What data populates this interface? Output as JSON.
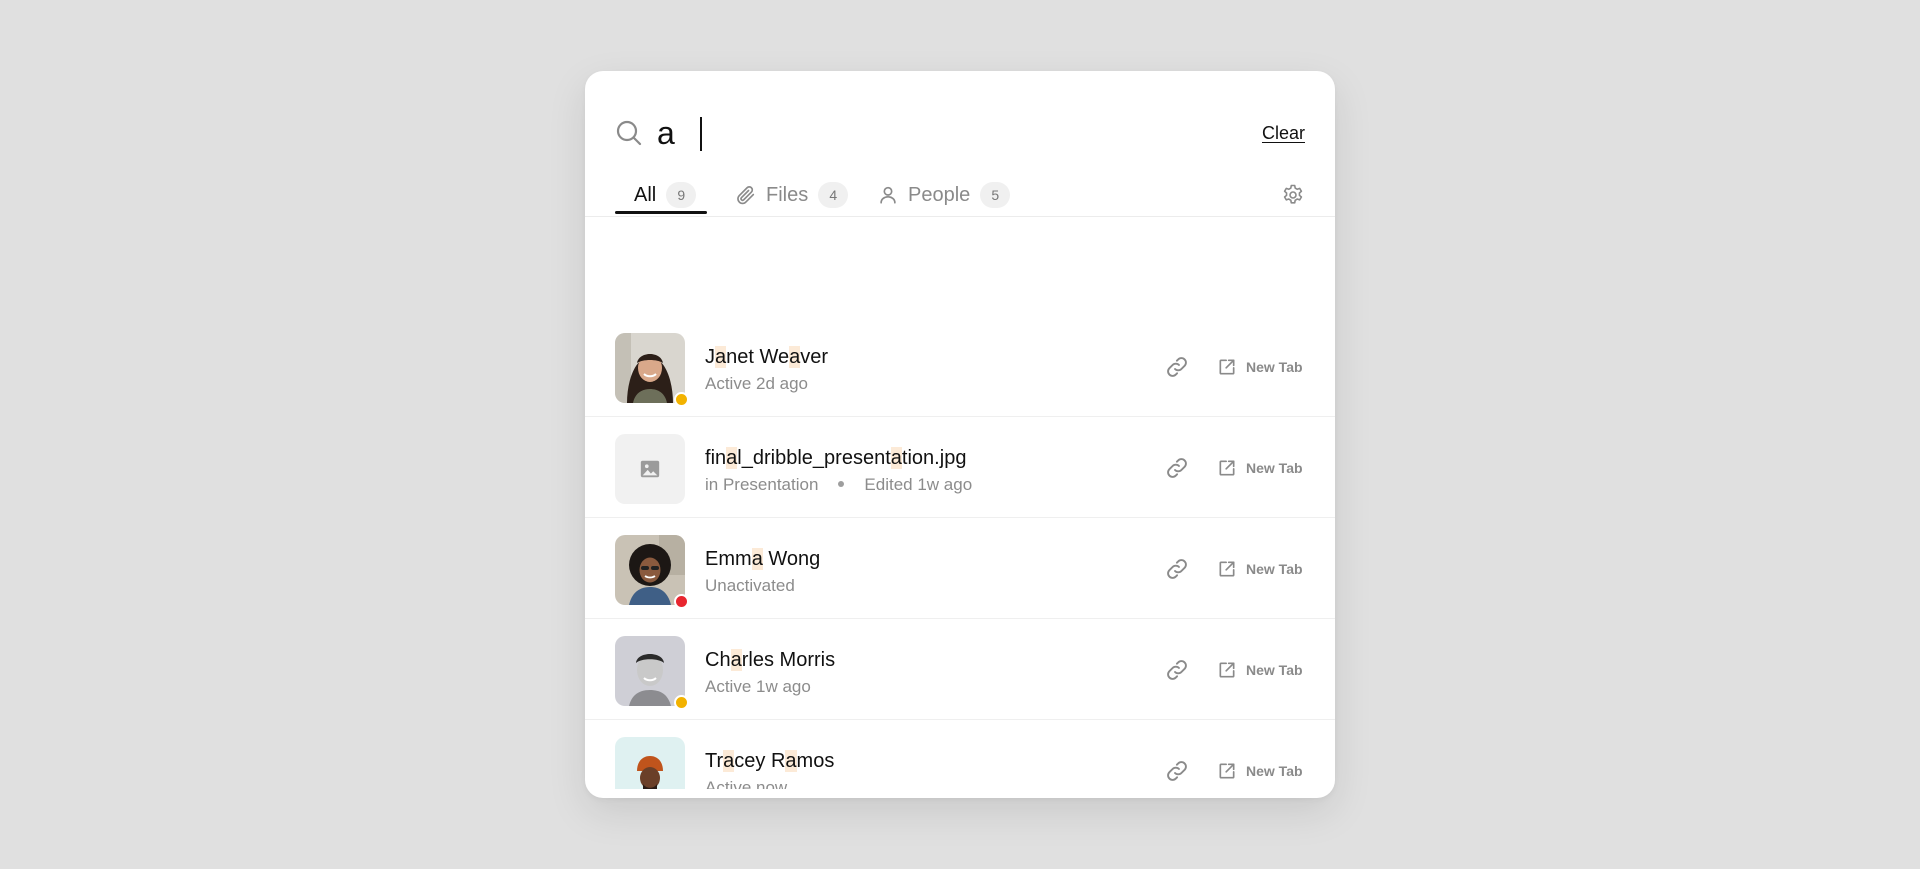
{
  "search": {
    "value": "a",
    "clear_label": "Clear"
  },
  "tabs": [
    {
      "label": "All",
      "count": "9",
      "icon": "",
      "active": true
    },
    {
      "label": "Files",
      "count": "4",
      "icon": "paperclip-icon",
      "active": false
    },
    {
      "label": "People",
      "count": "5",
      "icon": "user-icon",
      "active": false
    }
  ],
  "settings_icon": "gear-icon",
  "colors": {
    "status_away": "#f2b200",
    "status_inactive": "#e8262f",
    "highlight": "#fcead7"
  },
  "results": [
    {
      "type": "person",
      "title": "Janet Weaver",
      "subtitle": "Active 2d ago",
      "status": "away",
      "action_label": "New Tab"
    },
    {
      "type": "file",
      "title": "final_dribble_presentation.jpg",
      "location": "in Presentation",
      "edited": "Edited 1w ago",
      "action_label": "New Tab"
    },
    {
      "type": "person",
      "title": "Emma Wong",
      "subtitle": "Unactivated",
      "status": "inactive",
      "action_label": "New Tab"
    },
    {
      "type": "person",
      "title": "Charles Morris",
      "subtitle": "Active 1w ago",
      "status": "away",
      "action_label": "New Tab"
    },
    {
      "type": "person",
      "title": "Tracey Ramos",
      "subtitle": "Active now",
      "status": "active",
      "action_label": "New Tab"
    }
  ]
}
